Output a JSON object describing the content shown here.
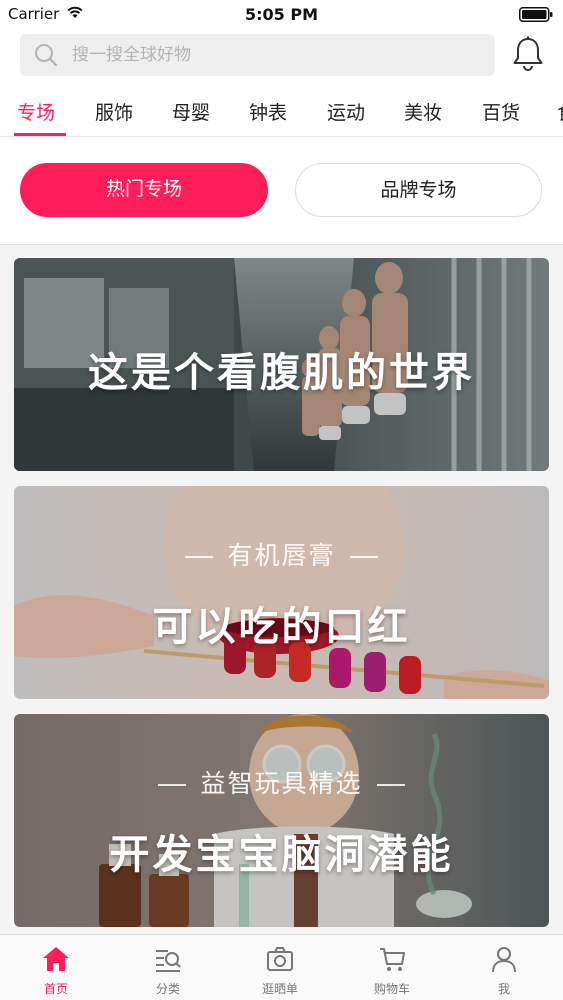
{
  "status_bar": {
    "carrier": "Carrier",
    "time": "5:05 PM"
  },
  "search": {
    "placeholder": "搜一搜全球好物"
  },
  "categories": [
    "专场",
    "服饰",
    "母婴",
    "钟表",
    "运动",
    "美妆",
    "百货",
    "食"
  ],
  "active_category_index": 0,
  "segments": {
    "hot": "热门专场",
    "brand": "品牌专场"
  },
  "banners": [
    {
      "subtitle": "",
      "title": "这是个看腹肌的世界"
    },
    {
      "subtitle": "有机唇膏",
      "title": "可以吃的口红"
    },
    {
      "subtitle": "益智玩具精选",
      "title": "开发宝宝脑洞潜能"
    }
  ],
  "tabbar": {
    "items": [
      {
        "label": "首页",
        "icon": "home-icon"
      },
      {
        "label": "分类",
        "icon": "category-search-icon"
      },
      {
        "label": "逛晒单",
        "icon": "camera-icon"
      },
      {
        "label": "购物车",
        "icon": "cart-icon"
      },
      {
        "label": "我",
        "icon": "person-icon"
      }
    ],
    "active_index": 0
  },
  "colors": {
    "accent": "#ff1e5a",
    "inactive": "#777777"
  }
}
